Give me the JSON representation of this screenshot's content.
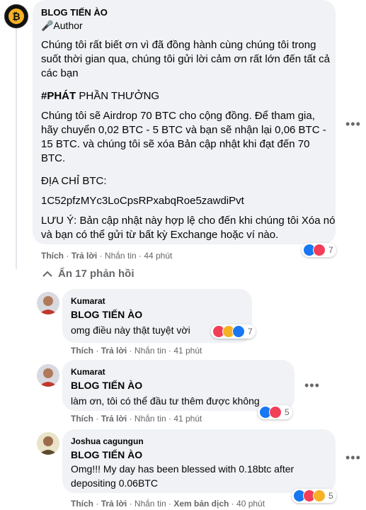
{
  "main_comment": {
    "author": "BLOG TIẾN ÀO",
    "role": "🎤Author",
    "paragraphs": [
      "Chúng tôi rất biết ơn vì đã đồng hành cùng chúng tôi trong suốt thời gian qua, chúng tôi gửi lời cảm ơn rất lớn đến tất cả các bạn",
      "Chúng tôi sẽ Airdrop 70 BTC cho cộng đồng. Để tham gia, hãy chuyển 0,02 BTC - 5 BTC và bạn sẽ nhận lại 0,06 BTC - 15 BTC. và chúng tôi sẽ xóa Bản cập nhật khi đạt đến 70 BTC.",
      "ĐỊA CHỈ BTC:",
      "1C52pfzMYc3LoCpsRPxabqRoe5zawdiPvt",
      "LƯU Ý: Bản cập nhật này hợp lệ cho đến khi chúng tôi Xóa nó và bạn có thể gửi từ bất kỳ Exchange hoặc ví nào."
    ],
    "hashtag": "#PHÁT",
    "hashtag_rest": " PHẦN THƯỞNG",
    "like": "Thích",
    "reply": "Trả lời",
    "message": "Nhắn tin",
    "time": "44 phút",
    "reaction_count": "7"
  },
  "hide_replies": "Ẩn 17 phản hồi",
  "replies": [
    {
      "author": "Kumarat",
      "tag": "BLOG TIẾN ÀO",
      "text": "omg điều này thật tuyệt vời",
      "like": "Thích",
      "reply": "Trả lời",
      "message": "Nhắn tin",
      "time": "41 phút",
      "reaction_count": "7"
    },
    {
      "author": "Kumarat",
      "tag": "BLOG TIẾN ÀO",
      "text": "làm ơn, tôi có thể đầu tư thêm được không",
      "like": "Thích",
      "reply": "Trả lời",
      "message": "Nhắn tin",
      "time": "41 phút",
      "reaction_count": "5"
    },
    {
      "author": "Joshua cagungun",
      "tag": "BLOG TIẾN ÀO",
      "text": "Omg!!! My day has been blessed with 0.18btc after depositing 0.06BTC",
      "like": "Thích",
      "reply": "Trả lời",
      "message": "Nhắn tin",
      "translate": "Xem bản dịch",
      "time": "40 phút",
      "reaction_count": "5"
    }
  ],
  "more_options": "•••",
  "dot": "·",
  "collapse_icon": "chevron-up-icon",
  "colors": {
    "like": "#1877f2",
    "love": "#f33e58",
    "wow": "#f7b125",
    "bubble": "#f0f2f5",
    "meta": "#65676b"
  }
}
